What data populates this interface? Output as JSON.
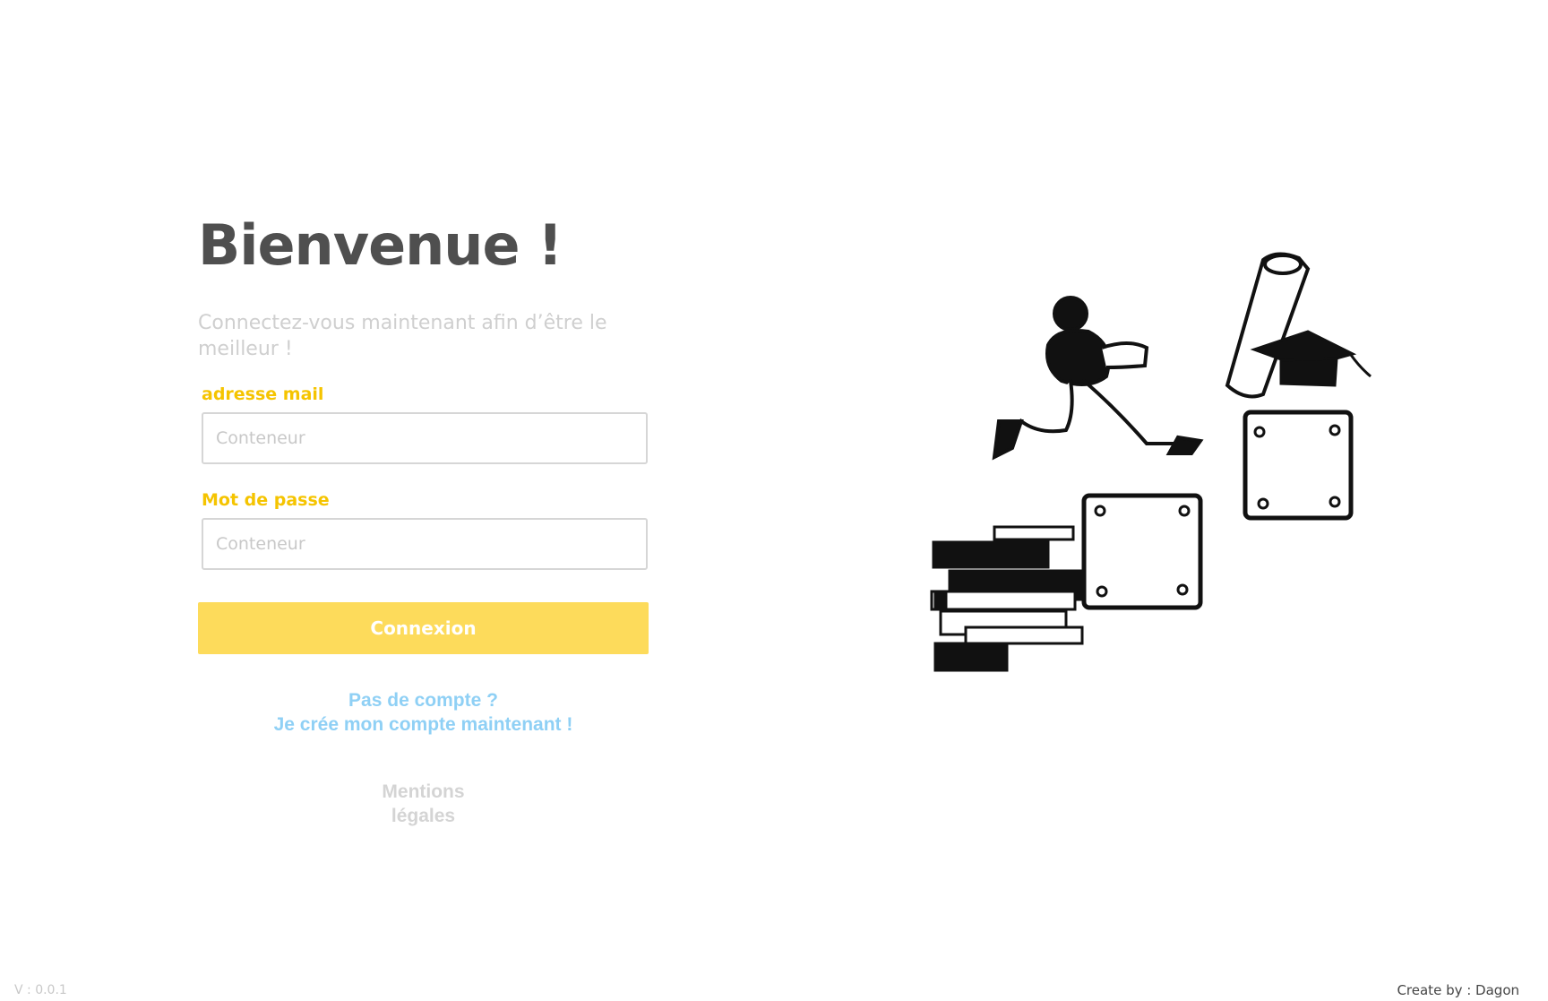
{
  "header": {
    "title": "Bienvenue !",
    "subtitle": "Connectez-vous maintenant afin d’être le meilleur !"
  },
  "form": {
    "email": {
      "label": "adresse mail",
      "placeholder": "Conteneur",
      "value": ""
    },
    "password": {
      "label": "Mot de passe",
      "placeholder": "Conteneur",
      "value": ""
    },
    "submit_label": "Connexion"
  },
  "signup": {
    "line1": "Pas de compte ?",
    "line2": "Je crée mon compte maintenant !"
  },
  "legal": {
    "line1": "Mentions",
    "line2": "légales"
  },
  "footer": {
    "version": "V : 0.0.1",
    "credit": "Create by : Dagon"
  },
  "illustration": {
    "icon": "student-running-up-steps-illustration"
  },
  "colors": {
    "accent_yellow": "#f5c400",
    "button_yellow": "#fddb5b",
    "link_blue": "#8fd0f5",
    "title_gray": "#4f4f4f",
    "muted_gray": "#cfcfcf"
  }
}
